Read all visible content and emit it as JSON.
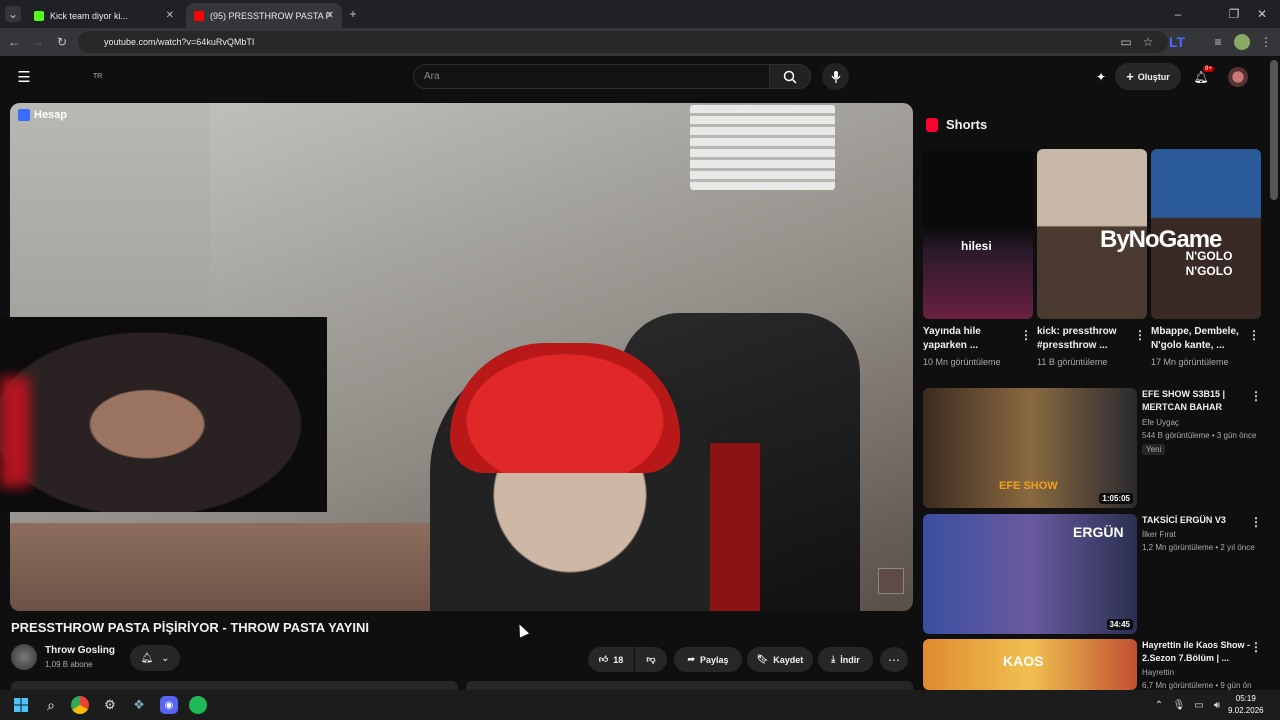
{
  "browser": {
    "tabs": [
      {
        "label": "Kick team diyor ki...",
        "favicon_color": "#53fc18"
      },
      {
        "label": "(95) PRESSTHROW PASTA P",
        "favicon_color": "#ff0000"
      }
    ],
    "url": "youtube.com/watch?v=64kuRvQMbTI"
  },
  "masthead": {
    "country": "TR",
    "search_placeholder": "Ara",
    "create_label": "Oluştur",
    "notif_count": "9+"
  },
  "player": {
    "watermark": "Hesap"
  },
  "video": {
    "title": "PRESSTHROW PASTA PİŞİRİYOR - THROW PASTA YAYINI",
    "channel": "Throw Gosling",
    "subscribers": "1,09 B abone",
    "likes": "18",
    "share_label": "Paylaş",
    "save_label": "Kaydet",
    "download_label": "İndir"
  },
  "sidebar": {
    "shorts_heading": "Shorts",
    "shorts": [
      {
        "title": "Yayında hile yaparken ...",
        "views": "10 Mn görüntüleme",
        "overlay": "hilesi"
      },
      {
        "title": "kick: pressthrow #pressthrow ...",
        "views": "11 B görüntüleme",
        "overlay": ""
      },
      {
        "title": "Mbappe, Dembele, N'golo kante, ...",
        "views": "17 Mn görüntüleme",
        "overlay": "N'GOLO N'GOLO"
      }
    ],
    "bynogame_logo": "ByNoGame",
    "videos": [
      {
        "title": "EFE SHOW S3B15 | MERTCAN BAHAR",
        "channel": "Efe Uygaç",
        "meta": "544 B görüntüleme • 3 gün önce",
        "badge": "Yeni",
        "duration": "1:05:05",
        "thumb_text": "EFE SHOW"
      },
      {
        "title": "TAKSİCİ ERGÜN V3",
        "channel": "İlker Fırat",
        "meta": "1,2 Mn görüntüleme • 2 yıl önce",
        "badge": "",
        "duration": "34:45",
        "thumb_text": "ERGÜN"
      },
      {
        "title": "Hayrettin ile Kaos Show - 2.Sezon 7.Bölüm | ...",
        "channel": "Hayrettin",
        "meta": "6,7 Mn görüntüleme • 9 gün ön",
        "badge": "",
        "duration": "",
        "thumb_text": "KAOS"
      }
    ]
  },
  "taskbar": {
    "time": "05:19",
    "date": "9.02.2026"
  }
}
